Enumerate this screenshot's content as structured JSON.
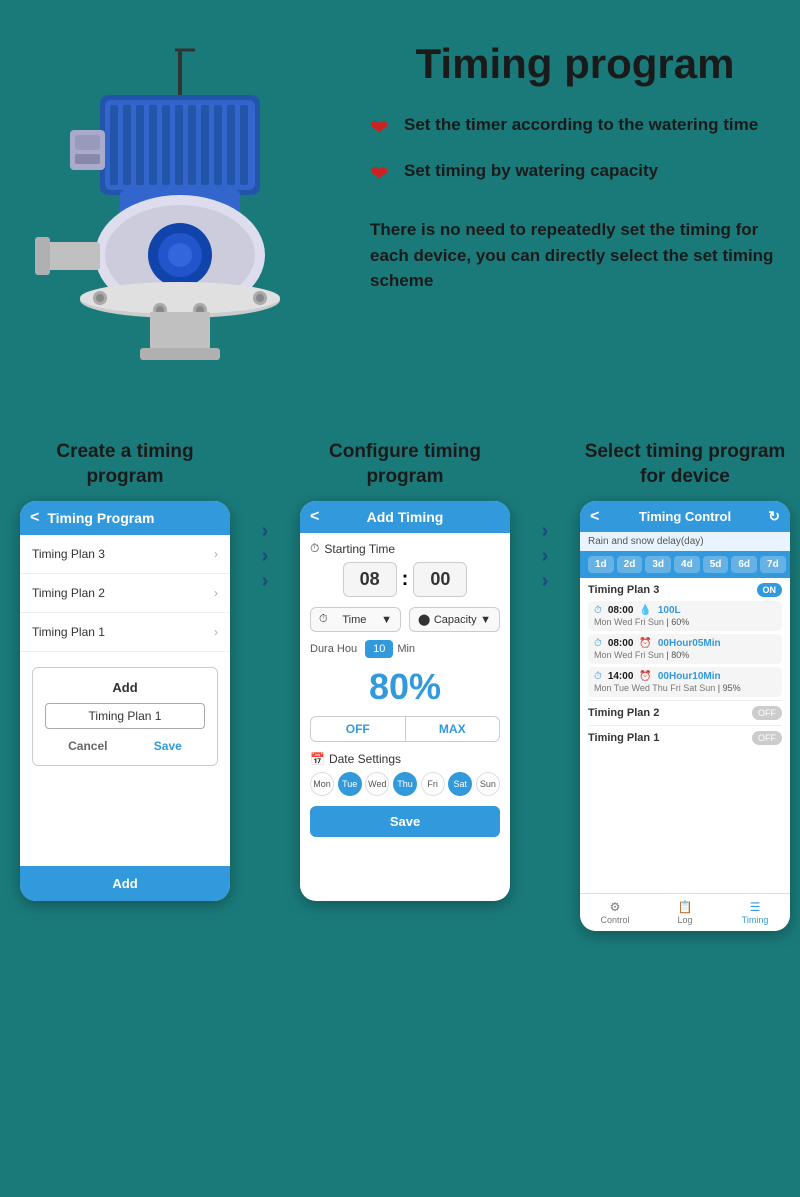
{
  "page": {
    "title": "Timing program",
    "bg_color": "#1a7a7a"
  },
  "features": {
    "item1": "Set the timer according to the watering time",
    "item2": "Set timing by watering capacity",
    "description": "There is no need to repeatedly set the timing for each device, you can directly select the set timing scheme"
  },
  "sections": {
    "create": {
      "title": "Create a timing\nprogram"
    },
    "configure": {
      "title": "Configure timing\nprogram"
    },
    "select": {
      "title": "Select timing program\nfor device"
    }
  },
  "phone1": {
    "header": "Timing Program",
    "items": [
      "Timing Plan 3",
      "Timing Plan 2",
      "Timing Plan 1"
    ],
    "add_label": "Add",
    "input_value": "Timing Plan 1",
    "cancel": "Cancel",
    "save": "Save",
    "bottom_btn": "Add"
  },
  "phone2": {
    "header": "Add Timing",
    "starting_time_label": "Starting Time",
    "hour": "08",
    "minute": "00",
    "type1": "Time",
    "type2": "Capacity",
    "dura_label": "Dura.",
    "hour_label": "Hour",
    "min_value": "10",
    "min_label": "Min",
    "percent": "80%",
    "off_label": "OFF",
    "max_label": "MAX",
    "date_label": "Date Settings",
    "days": [
      "Mon",
      "Tue",
      "Wed",
      "Thu",
      "Fri",
      "Sat",
      "Sun"
    ],
    "active_days": [
      "Tue",
      "Thu",
      "Sat"
    ],
    "save_btn": "Save"
  },
  "phone3": {
    "header": "Timing Control",
    "rain_label": "Rain and snow delay(day)",
    "day_pills": [
      "1d",
      "2d",
      "3d",
      "4d",
      "5d",
      "6d",
      "7d"
    ],
    "plan3_label": "Timing Plan 3",
    "plan3_toggle": "ON",
    "schedules": [
      {
        "time": "08:00",
        "value": "100L",
        "days": "Mon Wed Fri Sun",
        "percent": "60%"
      },
      {
        "time": "08:00",
        "value": "00Hour05Min",
        "days": "Mon Wed Fri Sun",
        "percent": "80%"
      },
      {
        "time": "14:00",
        "value": "00Hour10Min",
        "days": "Mon Tue Wed Thu Fri Sat Sun",
        "percent": "95%"
      }
    ],
    "plan2_label": "Timing Plan 2",
    "plan2_toggle": "OFF",
    "plan1_label": "Timing Plan 1",
    "plan1_toggle": "OFF",
    "nav": {
      "control": "Control",
      "log": "Log",
      "timing": "Timing"
    }
  },
  "dura_hou": "Dura Hou"
}
